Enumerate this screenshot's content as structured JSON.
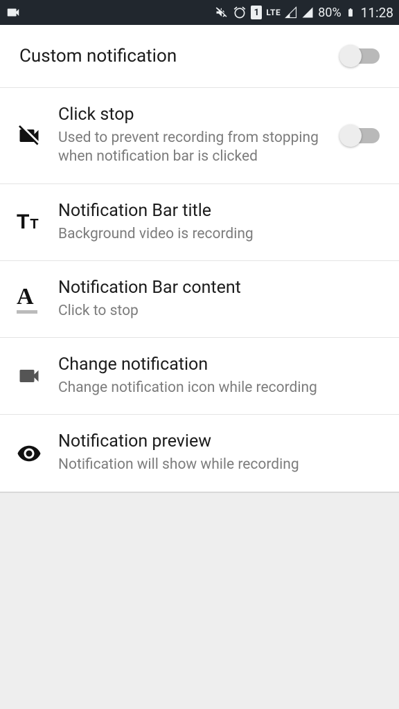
{
  "status_bar": {
    "battery": "80%",
    "time": "11:28",
    "lte": "LTE",
    "sim": "1"
  },
  "settings": {
    "header": {
      "title": "Custom notification"
    },
    "click_stop": {
      "title": "Click stop",
      "subtitle": "Used to prevent recording from stopping when notification bar is clicked"
    },
    "bar_title": {
      "title": "Notification Bar title",
      "subtitle": "Background video is recording"
    },
    "bar_content": {
      "title": "Notification Bar content",
      "subtitle": "Click to stop"
    },
    "change_notif": {
      "title": "Change notification",
      "subtitle": "Change notification icon while recording"
    },
    "preview": {
      "title": "Notification preview",
      "subtitle": "Notification will show while recording"
    }
  }
}
